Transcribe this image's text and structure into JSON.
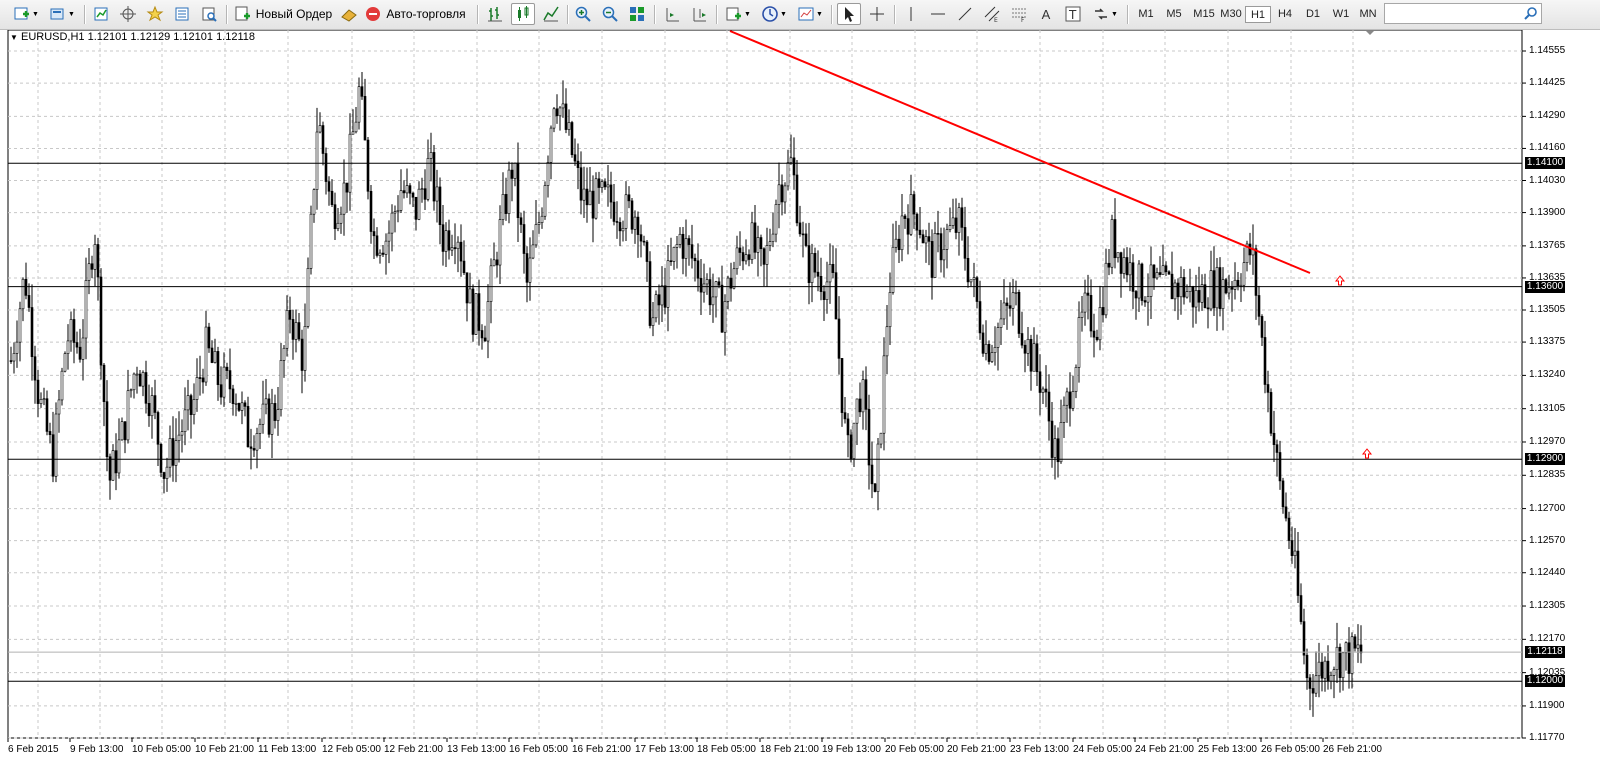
{
  "toolbar": {
    "buttons": [
      {
        "name": "new-chart-button",
        "icon": "new-chart-icon",
        "label": ""
      },
      {
        "name": "profiles-button",
        "icon": "profiles-icon",
        "label": ""
      },
      {
        "name": "market-watch-button",
        "icon": "market-watch-icon",
        "label": ""
      },
      {
        "name": "data-window-button",
        "icon": "crosshair-icon",
        "label": ""
      },
      {
        "name": "navigator-button",
        "icon": "navigator-icon",
        "label": ""
      },
      {
        "name": "terminal-button",
        "icon": "terminal-icon",
        "label": ""
      },
      {
        "name": "tester-button",
        "icon": "tester-icon",
        "label": ""
      }
    ],
    "new_order_label": "Новый Ордер",
    "auto_trading_label": "Авто-торговля",
    "timeframes": [
      "M1",
      "M5",
      "M15",
      "M30",
      "H1",
      "H4",
      "D1",
      "W1",
      "MN"
    ],
    "active_timeframe": "H1",
    "search_placeholder": ""
  },
  "chart": {
    "title": "EURUSD,H1  1.12101 1.12129 1.12101 1.12118",
    "symbol": "EURUSD",
    "timeframe": "H1",
    "price_axis": [
      "1.14555",
      "1.14425",
      "1.14290",
      "1.14160",
      "1.14030",
      "1.13900",
      "1.13765",
      "1.13635",
      "1.13505",
      "1.13375",
      "1.13240",
      "1.13105",
      "1.12970",
      "1.12835",
      "1.12700",
      "1.12570",
      "1.12440",
      "1.12305",
      "1.12170",
      "1.12035",
      "1.11900",
      "1.11770"
    ],
    "horizontal_levels": [
      "1.14100",
      "1.13600",
      "1.12900",
      "1.12000"
    ],
    "current_price": "1.12118",
    "date_axis": [
      "6 Feb 2015",
      "9 Feb 13:00",
      "10 Feb 05:00",
      "10 Feb 21:00",
      "11 Feb 13:00",
      "12 Feb 05:00",
      "12 Feb 21:00",
      "13 Feb 13:00",
      "16 Feb 05:00",
      "16 Feb 21:00",
      "17 Feb 13:00",
      "18 Feb 05:00",
      "18 Feb 21:00",
      "19 Feb 13:00",
      "20 Feb 05:00",
      "20 Feb 21:00",
      "23 Feb 13:00",
      "24 Feb 05:00",
      "24 Feb 21:00",
      "25 Feb 13:00",
      "26 Feb 05:00",
      "26 Feb 21:00"
    ],
    "colors": {
      "trendline": "#ff0000",
      "grid": "#c8c8c8",
      "candle": "#000000",
      "arrow": "#ff0000"
    }
  },
  "chart_data": {
    "type": "candlestick",
    "symbol": "EURUSD",
    "timeframe": "H1",
    "ylim": [
      1.1177,
      1.1462
    ],
    "path_close": [
      1.133,
      1.1365,
      1.1315,
      1.129,
      1.134,
      1.1335,
      1.1385,
      1.128,
      1.13,
      1.133,
      1.1315,
      1.1285,
      1.13,
      1.131,
      1.1335,
      1.132,
      1.132,
      1.13,
      1.1305,
      1.131,
      1.135,
      1.133,
      1.143,
      1.139,
      1.14,
      1.144,
      1.138,
      1.138,
      1.14,
      1.139,
      1.141,
      1.138,
      1.1385,
      1.135,
      1.1345,
      1.138,
      1.141,
      1.136,
      1.139,
      1.144,
      1.142,
      1.1395,
      1.1395,
      1.1395,
      1.139,
      1.139,
      1.1345,
      1.136,
      1.138,
      1.137,
      1.136,
      1.135,
      1.137,
      1.138,
      1.1365,
      1.14,
      1.141,
      1.137,
      1.1365,
      1.136,
      1.129,
      1.132,
      1.127,
      1.136,
      1.139,
      1.139,
      1.137,
      1.138,
      1.1385,
      1.136,
      1.1335,
      1.1345,
      1.1355,
      1.1335,
      1.132,
      1.129,
      1.132,
      1.135,
      1.1345,
      1.138,
      1.137,
      1.136,
      1.136,
      1.136,
      1.136,
      1.1355,
      1.136,
      1.136,
      1.1365,
      1.1375,
      1.1325,
      1.128,
      1.125,
      1.12,
      1.1205,
      1.121,
      1.121,
      1.1212
    ],
    "trendline": {
      "from_label": "18 Feb 05:00",
      "from_price": 1.1462,
      "to_label": "26 Feb 05:00",
      "to_price": 1.1365
    },
    "horizontal_levels": [
      1.141,
      1.136,
      1.129,
      1.12
    ],
    "last_price": 1.12118
  }
}
